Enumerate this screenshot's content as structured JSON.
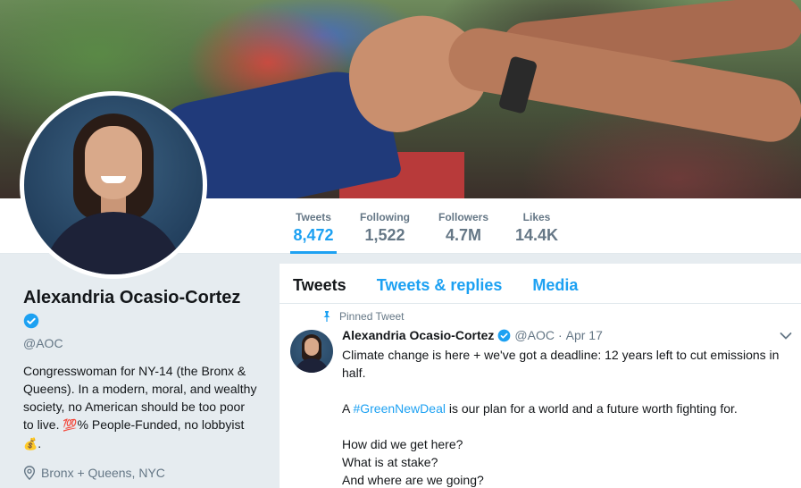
{
  "stats": [
    {
      "label": "Tweets",
      "value": "8,472"
    },
    {
      "label": "Following",
      "value": "1,522"
    },
    {
      "label": "Followers",
      "value": "4.7M"
    },
    {
      "label": "Likes",
      "value": "14.4K"
    }
  ],
  "profile": {
    "name": "Alexandria Ocasio-Cortez",
    "handle": "@AOC",
    "bio_part1": "Congresswoman for NY-14 (the Bronx & Queens). In a modern, moral, and wealthy society, no American should be too poor to live. ",
    "bio_emoji_100": "💯",
    "bio_part2": "% People-Funded, no lobbyist ",
    "bio_emoji_money": "💰",
    "bio_part3": ".",
    "location": "Bronx + Queens, NYC"
  },
  "tabs": [
    "Tweets",
    "Tweets & replies",
    "Media"
  ],
  "tweet": {
    "pinned_label": "Pinned Tweet",
    "author_name": "Alexandria Ocasio-Cortez",
    "author_handle": "@AOC",
    "separator": "·",
    "date": "Apr 17",
    "lines": [
      "Climate change is here + we've got a deadline: 12 years left to cut emissions in half.",
      "How did we get here?",
      "What is at stake?",
      "And where are we going?"
    ],
    "line2_prefix": "A ",
    "hashtag": "#GreenNewDeal",
    "line2_suffix": " is our plan for a world and a future worth fighting for."
  },
  "colors": {
    "accent": "#1da1f2",
    "secondary_text": "#657786",
    "background": "#e6ecf0"
  },
  "icons": [
    "verified-badge-icon",
    "location-pin-icon",
    "pin-icon",
    "chevron-down-icon"
  ]
}
